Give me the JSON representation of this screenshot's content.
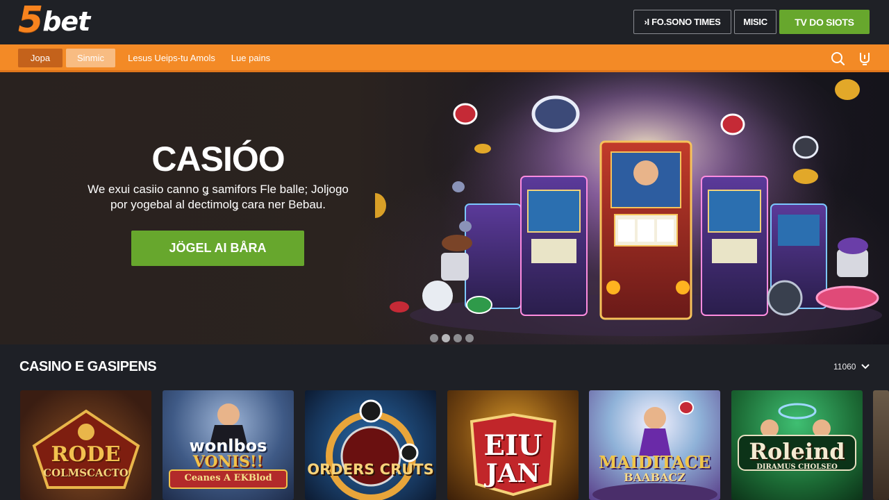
{
  "header": {
    "logo_number": "5",
    "logo_word": "bet",
    "buttons": [
      {
        "label": "›I FO.SONO TIMES"
      },
      {
        "label": "MISIC"
      },
      {
        "label": "TV DO SIOTS"
      }
    ]
  },
  "nav": {
    "tabs": [
      {
        "label": "Jopa"
      },
      {
        "label": "Sinmic"
      },
      {
        "label": "Lesus Ueips-tu Amols"
      },
      {
        "label": "Lue pains"
      }
    ]
  },
  "hero": {
    "title": "CASIÓO",
    "subtitle": "We exui casiio canno ǥ samifors Fle balle; Joljogo por yogebal al dectimolǥ cara ner Bebau.",
    "cta_label": "JÖGEL AI BÅRA",
    "slide_count": 4,
    "active_slide": 2
  },
  "section": {
    "title": "CASINO E GASIPENS",
    "filter_label": "11060"
  },
  "games": [
    {
      "title_line1": "RODE",
      "title_line2": "COLMSCACTO",
      "bg": "#5a2d1a",
      "accent": "#e9b64a"
    },
    {
      "title_line1": "wonlbos",
      "title_line2": "VONIS!!",
      "title_line3": "Ceanes A EKBlod",
      "bg": "#3f5a86",
      "accent": "#f2c24a"
    },
    {
      "title_line1": "ORDERS CRUTS",
      "bg": "#1c3f66",
      "accent": "#e8a53a"
    },
    {
      "title_line1": "EIU",
      "title_line2": "JAN",
      "bg": "#7a4a12",
      "accent": "#c1262a"
    },
    {
      "title_line1": "MAIDITACE",
      "title_line2": "BAABACZ",
      "bg": "#8fb2d8",
      "accent": "#f0c54a"
    },
    {
      "title_line1": "Roleind",
      "title_line2": "DIRAMUS CHOLSEO",
      "bg": "#1c6b35",
      "accent": "#e9e0c2"
    }
  ],
  "colors": {
    "brand_orange": "#f38a26",
    "cta_green": "#67a72d",
    "background": "#1e2026"
  }
}
